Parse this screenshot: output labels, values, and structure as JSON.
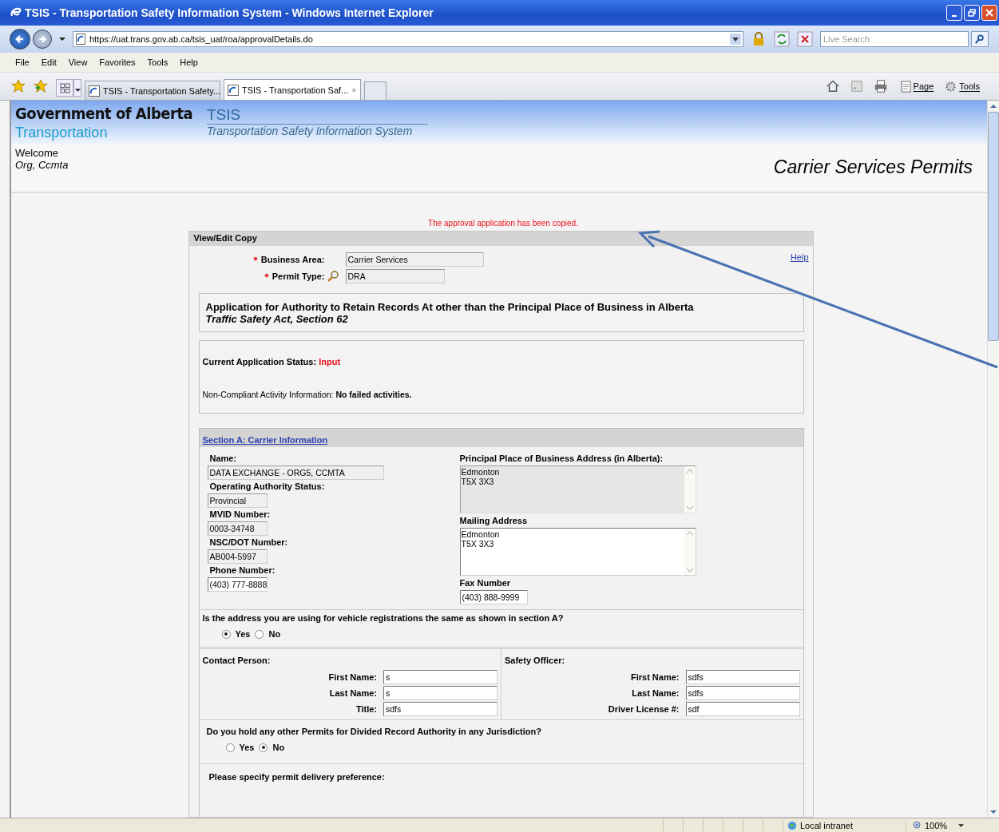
{
  "window": {
    "title": "TSIS - Transportation Safety Information System - Windows Internet Explorer"
  },
  "address_bar": {
    "url": "https://uat.trans.gov.ab.ca/tsis_uat/roa/approvalDetails.do",
    "search_placeholder": "Live Search"
  },
  "menu": [
    "File",
    "Edit",
    "View",
    "Favorites",
    "Tools",
    "Help"
  ],
  "tabs": [
    {
      "label": "TSIS - Transportation Safety...",
      "selected": false
    },
    {
      "label": "TSIS - Transportation Saf...",
      "selected": true
    }
  ],
  "command_bar": [
    "Page",
    "Tools"
  ],
  "header": {
    "org": "Government of Alberta",
    "dept": "Transportation",
    "app": "TSIS",
    "app_full": "Transportation Safety Information System"
  },
  "welcome": {
    "greeting": "Welcome",
    "user": "Org, Ccmta"
  },
  "page_title": "Carrier Services Permits",
  "message": "The approval application has been copied.",
  "form": {
    "title": "View/Edit Copy",
    "help": "Help",
    "top_fields": [
      {
        "label": "Business Area:",
        "value": "Carrier Services",
        "required": true,
        "lookup": false
      },
      {
        "label": "Permit Type:",
        "value": "DRA",
        "required": true,
        "lookup": true
      }
    ],
    "heading": "Application for Authority to Retain Records At other than the Principal Place of Business in Alberta",
    "subheading": "Traffic Safety Act, Section 62",
    "status_label": "Current Application Status:",
    "status": "Input",
    "noncompliant_label": "Non-Compliant Activity Information:",
    "noncompliant": "No failed activities.",
    "section_a": {
      "title": "Section A: Carrier Information",
      "left_fields": [
        {
          "label": "Name:",
          "value": "DATA EXCHANGE - ORG5, CCMTA",
          "readonly": true
        },
        {
          "label": "Operating Authority Status:",
          "value": "Provincial",
          "readonly": true
        },
        {
          "label": "MVID Number:",
          "value": "0003-34748",
          "readonly": true
        },
        {
          "label": "NSC/DOT Number:",
          "value": "AB004-5997",
          "readonly": true
        },
        {
          "label": "Phone Number:",
          "value": "(403) 777-8888",
          "readonly": false
        }
      ],
      "right_fields": [
        {
          "label": "Principal Place of Business Address (in Alberta):",
          "kind": "textarea",
          "readonly": true,
          "lines": [
            "Edmonton",
            "T5X 3X3"
          ]
        },
        {
          "label": "Mailing Address",
          "kind": "textarea",
          "readonly": false,
          "lines": [
            "Edmonton",
            "T5X 3X3"
          ]
        },
        {
          "label": "Fax Number",
          "kind": "input",
          "readonly": false,
          "lines": [
            "(403) 888-9999"
          ]
        }
      ]
    },
    "question_1": {
      "text": "Is the address you are using for vehicle registrations the same as shown in section A?",
      "options": [
        {
          "label": "Yes",
          "selected": true
        },
        {
          "label": "No",
          "selected": false
        }
      ]
    },
    "contact": {
      "title": "Contact Person:",
      "fields": [
        {
          "label": "First Name:",
          "value": "s"
        },
        {
          "label": "Last Name:",
          "value": "s"
        },
        {
          "label": "Title:",
          "value": "sdfs"
        }
      ]
    },
    "safety_officer": {
      "title": "Safety Officer:",
      "fields": [
        {
          "label": "First Name:",
          "value": "sdfs"
        },
        {
          "label": "Last Name:",
          "value": "sdfs"
        },
        {
          "label": "Driver License #:",
          "value": "sdf"
        }
      ]
    },
    "question_2": {
      "text": "Do you hold any other Permits for Divided Record Authority in any Jurisdiction?",
      "options": [
        {
          "label": "Yes",
          "selected": false
        },
        {
          "label": "No",
          "selected": true
        }
      ]
    },
    "delivery": {
      "text": "Please specify permit delivery preference:"
    }
  },
  "status_bar": {
    "zone": "Local intranet",
    "zoom": "100%"
  }
}
